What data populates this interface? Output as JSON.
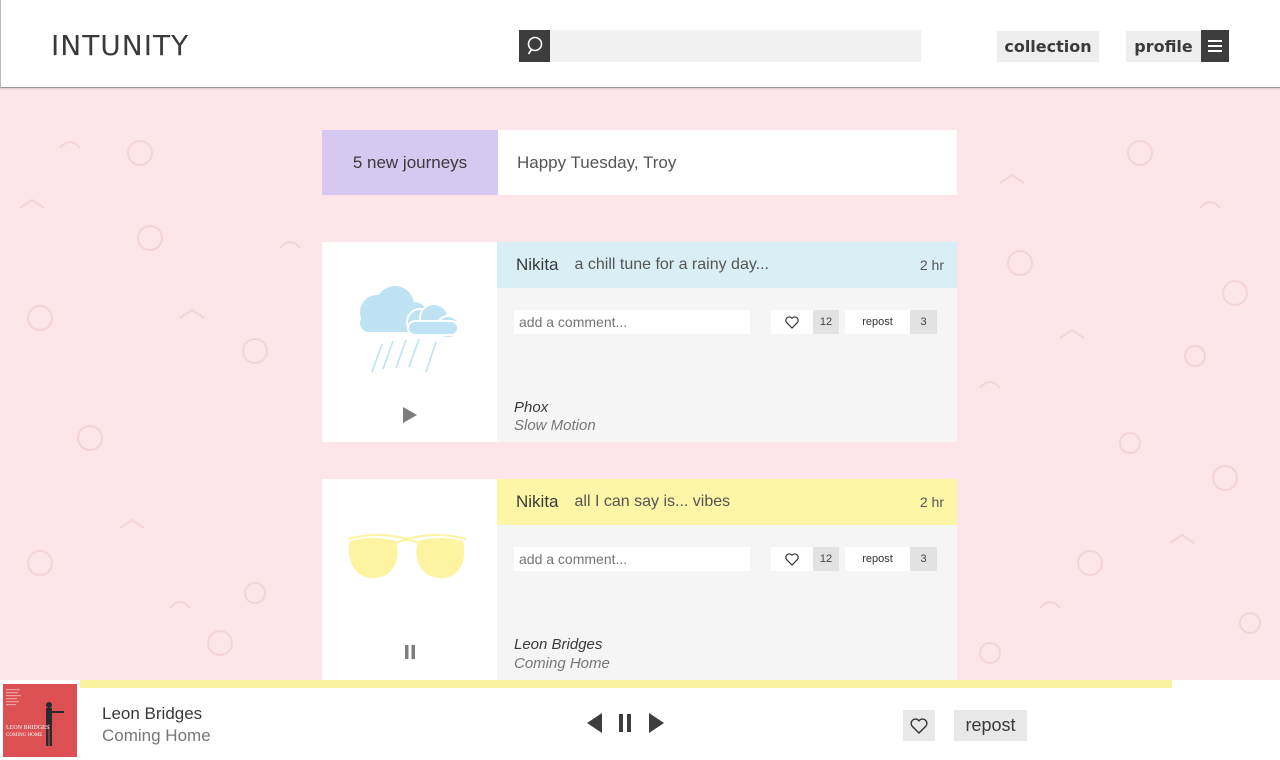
{
  "header": {
    "logo": "INTUNITY",
    "search": {
      "placeholder": "",
      "value": ""
    },
    "nav": {
      "collection": "collection",
      "profile": "profile"
    }
  },
  "banner": {
    "journeys": "5 new journeys",
    "greeting": "Happy Tuesday, Troy"
  },
  "posts": [
    {
      "user": "Nikita",
      "caption": "a chill tune for a rainy day...",
      "time": "2 hr",
      "header_color": "#daeef6",
      "art_icon": "rain-cloud-icon",
      "art_color": "#bfe3f2",
      "comment_placeholder": "add a comment...",
      "likes": "12",
      "repost_label": "repost",
      "reposts": "3",
      "artist": "Phox",
      "track": "Slow Motion",
      "state": "paused"
    },
    {
      "user": "Nikita",
      "caption": "all I can say is... vibes",
      "time": "2 hr",
      "header_color": "#fdf6a7",
      "art_icon": "sunglasses-icon",
      "art_color": "#fdf3a0",
      "comment_placeholder": "add a comment...",
      "likes": "12",
      "repost_label": "repost",
      "reposts": "3",
      "artist": "Leon Bridges",
      "track": "Coming Home",
      "state": "playing"
    }
  ],
  "player": {
    "artist": "Leon Bridges",
    "track": "Coming Home",
    "album_art_text": [
      "LEON BRIDGES",
      "COMING HOME"
    ],
    "repost_label": "repost",
    "progress_color": "#fbf3a0"
  },
  "colors": {
    "background": "#fde5e9",
    "journeys": "#d7c8f1",
    "dark": "#3d3d3d"
  }
}
